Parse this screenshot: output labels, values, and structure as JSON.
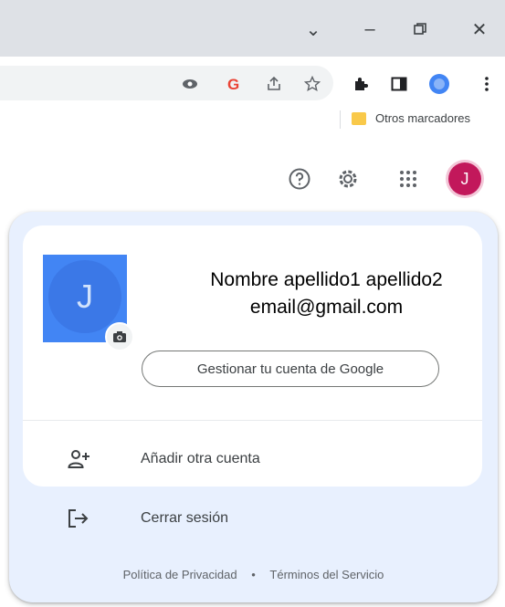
{
  "window_controls": {
    "tab_search": "⌄",
    "minimize": "–",
    "restore": "⧉",
    "close": "✕"
  },
  "toolbar_icons": [
    "eye-icon",
    "google-lens-icon",
    "share-icon",
    "bookmark-star-icon",
    "extensions-icon",
    "side-panel-icon",
    "profile-icon",
    "menu-icon"
  ],
  "bookmarks": {
    "other_folder_label": "Otros marcadores"
  },
  "google_bar": {
    "avatar_letter": "J",
    "avatar_color": "#c2185b"
  },
  "account": {
    "avatar_letter": "J",
    "name": "Nombre apellido1 apellido2",
    "email": "email@gmail.com",
    "manage_button": "Gestionar tu cuenta de Google"
  },
  "menu": {
    "add_account": "Añadir otra cuenta",
    "sign_out": "Cerrar sesión"
  },
  "footer": {
    "privacy": "Política de Privacidad",
    "separator": "•",
    "terms": "Términos del Servicio"
  },
  "colors": {
    "popup_bg": "#e8f0fe",
    "accent_blue": "#4285f4"
  }
}
